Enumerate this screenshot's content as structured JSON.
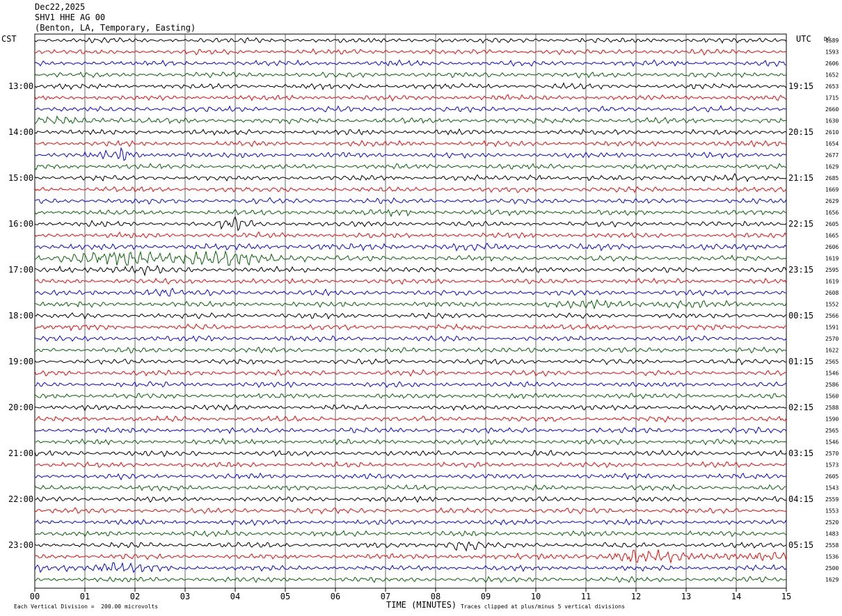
{
  "header": {
    "date": "Dec22,2025",
    "station": "SHV1 HHE AG 00",
    "location": "(Benton, LA, Temporary, Easting)"
  },
  "left_tz": "CST",
  "right_tz": "UTC",
  "dc_header": "DC",
  "footer": {
    "scale": "Each Vertical Division =  200.00 microvolts",
    "x_title": "TIME (MINUTES)",
    "clip_note": "Traces clipped at plus/minus 5 vertical divisions"
  },
  "colors": {
    "black": "#000000",
    "red": "#ff0000",
    "blue": "#0000ff",
    "green": "#006400",
    "grid": "#000000"
  },
  "chart_data": {
    "type": "line",
    "subtype": "helicorder",
    "x_ticks": [
      "00",
      "01",
      "02",
      "03",
      "04",
      "05",
      "06",
      "07",
      "08",
      "09",
      "10",
      "11",
      "12",
      "13",
      "14",
      "15"
    ],
    "xlim": [
      0,
      15
    ],
    "traces_per_hour": 4,
    "trace_color_cycle": [
      "black",
      "red",
      "blue",
      "green"
    ],
    "left_hour_labels": [
      "13:00",
      "14:00",
      "15:00",
      "16:00",
      "17:00",
      "18:00",
      "19:00",
      "20:00",
      "21:00",
      "22:00",
      "23:00"
    ],
    "right_hour_labels": [
      "19:15",
      "20:15",
      "21:15",
      "22:15",
      "23:15",
      "00:15",
      "01:15",
      "02:15",
      "03:15",
      "04:15",
      "05:15"
    ],
    "dc_offsets": [
      "1589",
      "1593",
      "2606",
      "1652",
      "2653",
      "1715",
      "2660",
      "1630",
      "2610",
      "1654",
      "2677",
      "1629",
      "2685",
      "1669",
      "2629",
      "1656",
      "2605",
      "1665",
      "2606",
      "1619",
      "2595",
      "1619",
      "2608",
      "1552",
      "2566",
      "1591",
      "2570",
      "1622",
      "2565",
      "1546",
      "2586",
      "1560",
      "2588",
      "1590",
      "2565",
      "1546",
      "2570",
      "1573",
      "2605",
      "1543",
      "2559",
      "1553",
      "2520",
      "1483",
      "2558",
      "1536",
      "2500",
      "1629"
    ],
    "events": [
      {
        "trace": 7,
        "start_min": 0.0,
        "end_min": 1.8,
        "amp": 1.6
      },
      {
        "trace": 10,
        "start_min": 1.3,
        "end_min": 2.2,
        "amp": 2.2
      },
      {
        "trace": 10,
        "start_min": 4.0,
        "end_min": 4.8,
        "amp": 1.5
      },
      {
        "trace": 12,
        "start_min": 9.6,
        "end_min": 10.4,
        "amp": 1.8
      },
      {
        "trace": 12,
        "start_min": 12.0,
        "end_min": 15.0,
        "amp": 1.2
      },
      {
        "trace": 15,
        "start_min": 7.0,
        "end_min": 7.6,
        "amp": 1.5
      },
      {
        "trace": 16,
        "start_min": 3.5,
        "end_min": 4.5,
        "amp": 2.2
      },
      {
        "trace": 18,
        "start_min": 0.0,
        "end_min": 15.0,
        "amp": 1.2
      },
      {
        "trace": 19,
        "start_min": 0.0,
        "end_min": 5.5,
        "amp": 2.6
      },
      {
        "trace": 20,
        "start_min": 0.5,
        "end_min": 3.0,
        "amp": 1.6
      },
      {
        "trace": 22,
        "start_min": 1.9,
        "end_min": 2.8,
        "amp": 2.0
      },
      {
        "trace": 23,
        "start_min": 10.0,
        "end_min": 14.0,
        "amp": 1.5
      },
      {
        "trace": 44,
        "start_min": 8.0,
        "end_min": 9.0,
        "amp": 2.2
      },
      {
        "trace": 45,
        "start_min": 10.0,
        "end_min": 15.0,
        "amp": 1.8
      },
      {
        "trace": 46,
        "start_min": 0.0,
        "end_min": 2.5,
        "amp": 2.0
      },
      {
        "trace": 47,
        "start_min": 10.1,
        "end_min": 10.5,
        "amp": 1.4
      }
    ]
  }
}
